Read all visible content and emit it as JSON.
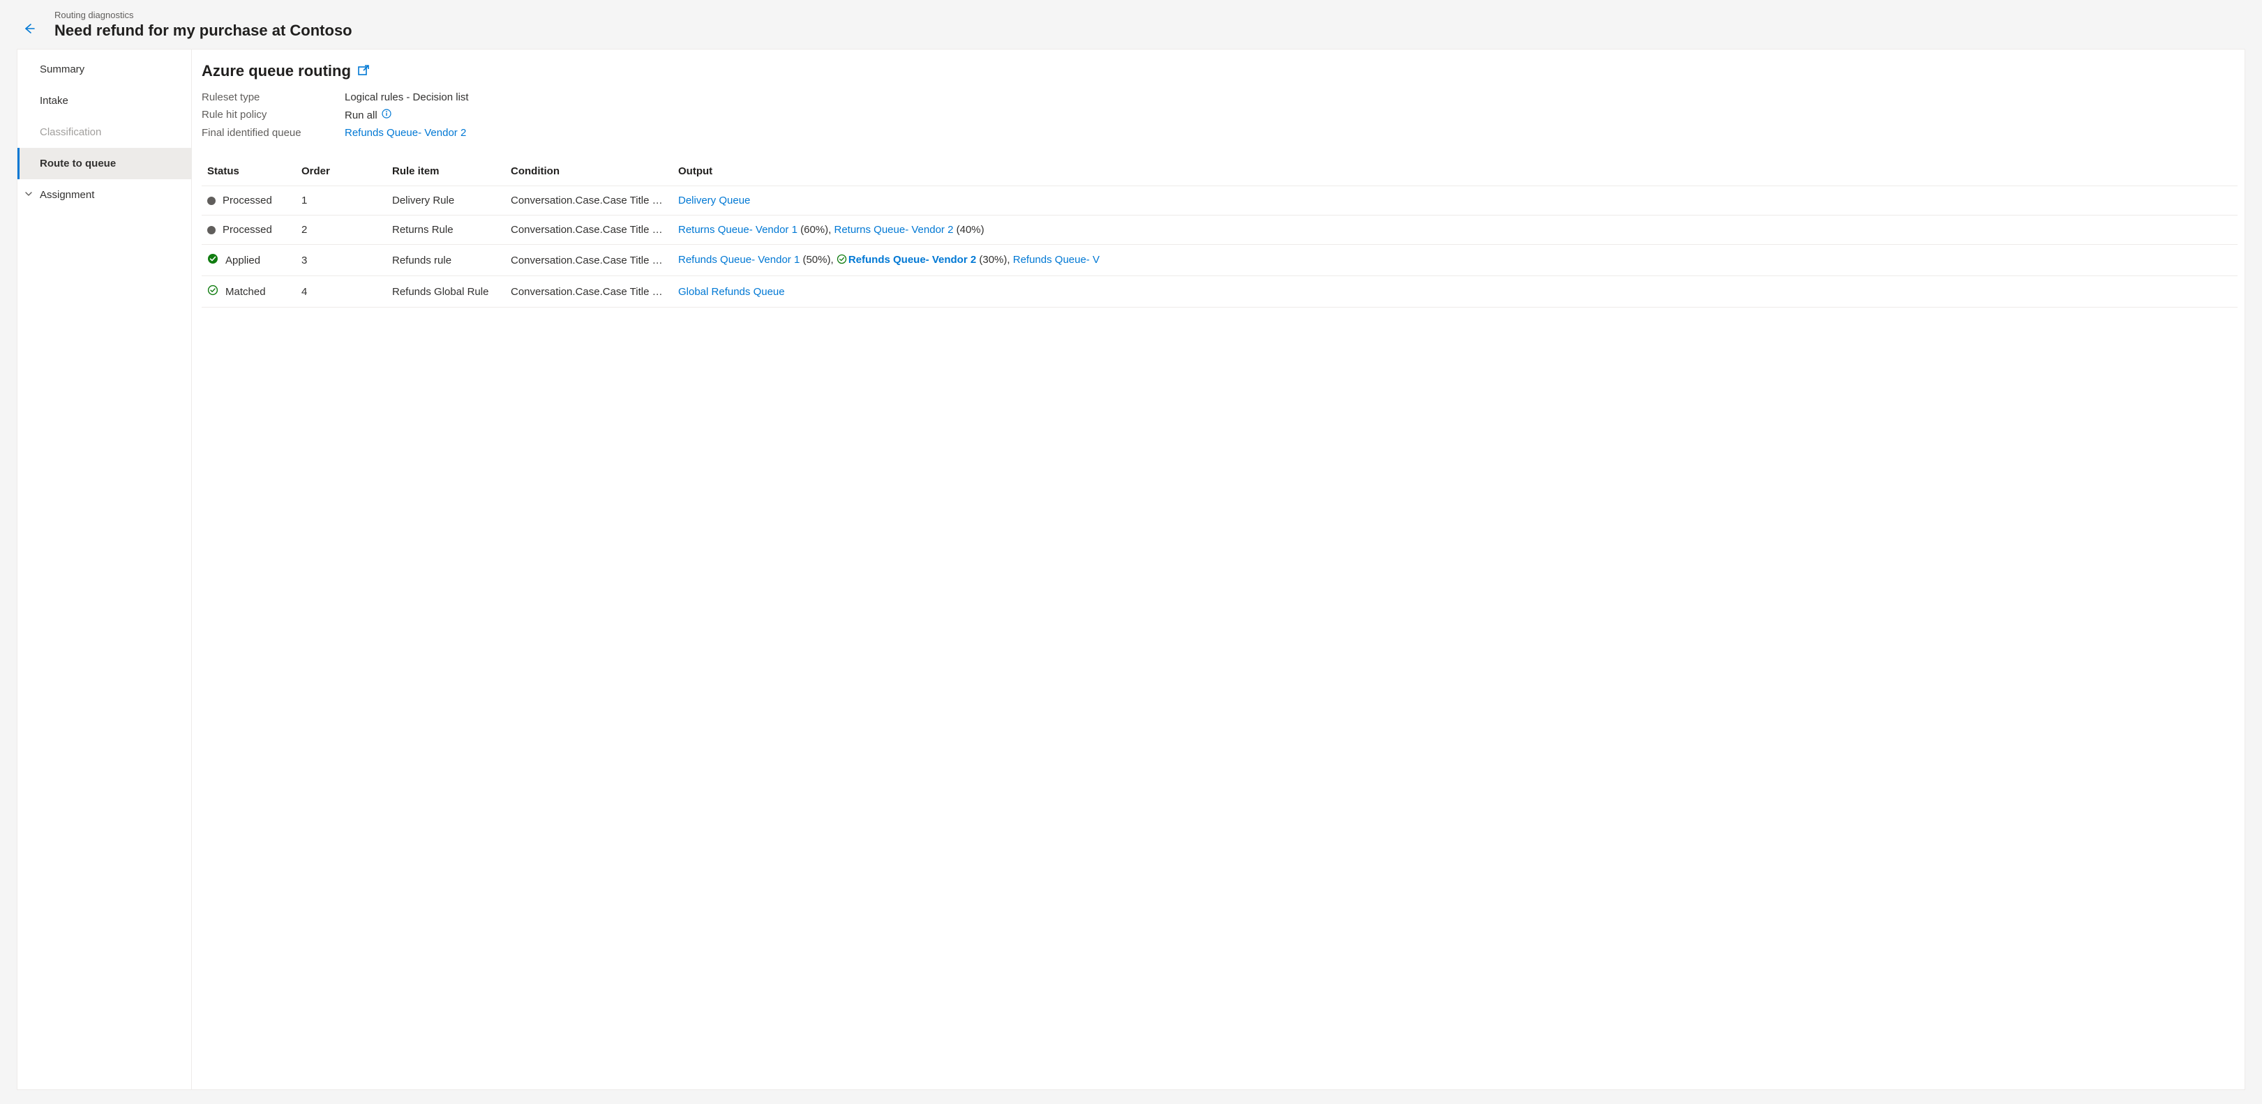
{
  "header": {
    "crumb": "Routing diagnostics",
    "title": "Need refund for my purchase at Contoso"
  },
  "sidebar": {
    "items": [
      {
        "label": "Summary",
        "kind": "item",
        "active": false,
        "disabled": false
      },
      {
        "label": "Intake",
        "kind": "item",
        "active": false,
        "disabled": false
      },
      {
        "label": "Classification",
        "kind": "item",
        "active": false,
        "disabled": true
      },
      {
        "label": "Route to queue",
        "kind": "item",
        "active": true,
        "disabled": false
      },
      {
        "label": "Assignment",
        "kind": "expandable",
        "active": false,
        "disabled": false
      }
    ]
  },
  "main": {
    "title": "Azure queue routing",
    "meta": {
      "ruleset_type_label": "Ruleset type",
      "ruleset_type_value": "Logical rules - Decision list",
      "rule_hit_policy_label": "Rule hit policy",
      "rule_hit_policy_value": "Run all",
      "final_queue_label": "Final identified queue",
      "final_queue_link": "Refunds Queue- Vendor 2"
    },
    "table": {
      "headers": {
        "status": "Status",
        "order": "Order",
        "rule_item": "Rule item",
        "condition": "Condition",
        "output": "Output"
      },
      "rows": [
        {
          "status_icon": "processed",
          "status": "Processed",
          "order": "1",
          "rule_item": "Delivery Rule",
          "condition": "Conversation.Case.Case Title c…",
          "outputs": [
            {
              "text": "Delivery Queue",
              "pct": "",
              "selected": false
            }
          ]
        },
        {
          "status_icon": "processed",
          "status": "Processed",
          "order": "2",
          "rule_item": "Returns Rule",
          "condition": "Conversation.Case.Case Title c…",
          "outputs": [
            {
              "text": "Returns Queue- Vendor 1",
              "pct": " (60%)",
              "selected": false,
              "trail": ", "
            },
            {
              "text": "Returns Queue- Vendor 2",
              "pct": " (40%)",
              "selected": false
            }
          ]
        },
        {
          "status_icon": "applied",
          "status": "Applied",
          "order": "3",
          "rule_item": "Refunds rule",
          "condition": "Conversation.Case.Case Title c…",
          "outputs": [
            {
              "text": "Refunds Queue- Vendor 1",
              "pct": " (50%)",
              "selected": false,
              "trail": ", "
            },
            {
              "text": "Refunds Queue- Vendor 2",
              "pct": " (30%)",
              "selected": true,
              "trail": ", "
            },
            {
              "text": "Refunds Queue- V",
              "pct": "",
              "selected": false
            }
          ]
        },
        {
          "status_icon": "matched",
          "status": "Matched",
          "order": "4",
          "rule_item": "Refunds Global Rule",
          "condition": "Conversation.Case.Case Title c…",
          "outputs": [
            {
              "text": "Global Refunds Queue",
              "pct": "",
              "selected": false
            }
          ]
        }
      ]
    }
  }
}
